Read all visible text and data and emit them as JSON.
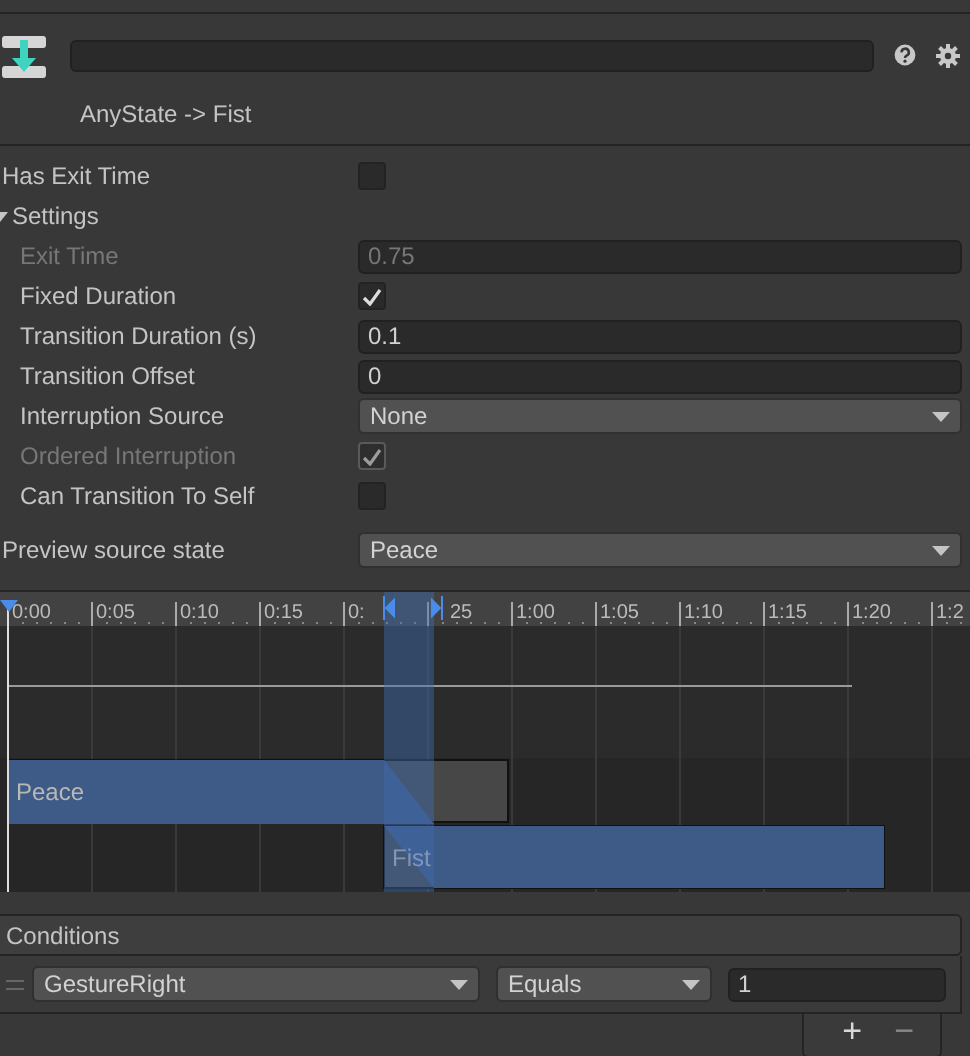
{
  "header": {
    "title": "AnyState -> Fist"
  },
  "has_exit_time": {
    "label": "Has Exit Time",
    "checked": false
  },
  "settings": {
    "label": "Settings",
    "expanded": true,
    "rows": [
      {
        "kind": "field",
        "label": "Exit Time",
        "value": "0.75",
        "disabled": true
      },
      {
        "kind": "checkbox",
        "label": "Fixed Duration",
        "checked": true,
        "disabled": false
      },
      {
        "kind": "field",
        "label": "Transition Duration (s)",
        "value": "0.1",
        "disabled": false
      },
      {
        "kind": "field",
        "label": "Transition Offset",
        "value": "0",
        "disabled": false
      },
      {
        "kind": "dropdown",
        "label": "Interruption Source",
        "value": "None",
        "disabled": false
      },
      {
        "kind": "checkbox",
        "label": "Ordered Interruption",
        "checked": true,
        "disabled": true
      },
      {
        "kind": "checkbox",
        "label": "Can Transition To Self",
        "checked": false,
        "disabled": false
      }
    ]
  },
  "preview": {
    "label": "Preview source state",
    "value": "Peace"
  },
  "timeline": {
    "ticks": [
      "0:00",
      "0:05",
      "0:10",
      "0:15",
      "0:",
      "25",
      "1:00",
      "1:05",
      "1:10",
      "1:15",
      "1:20",
      "1:2"
    ],
    "clips": [
      {
        "label": "Peace"
      },
      {
        "label": "Fist"
      }
    ]
  },
  "conditions": {
    "title": "Conditions",
    "items": [
      {
        "parameter": "GestureRight",
        "mode": "Equals",
        "value": "1"
      }
    ],
    "add": "+",
    "remove": "−"
  }
}
